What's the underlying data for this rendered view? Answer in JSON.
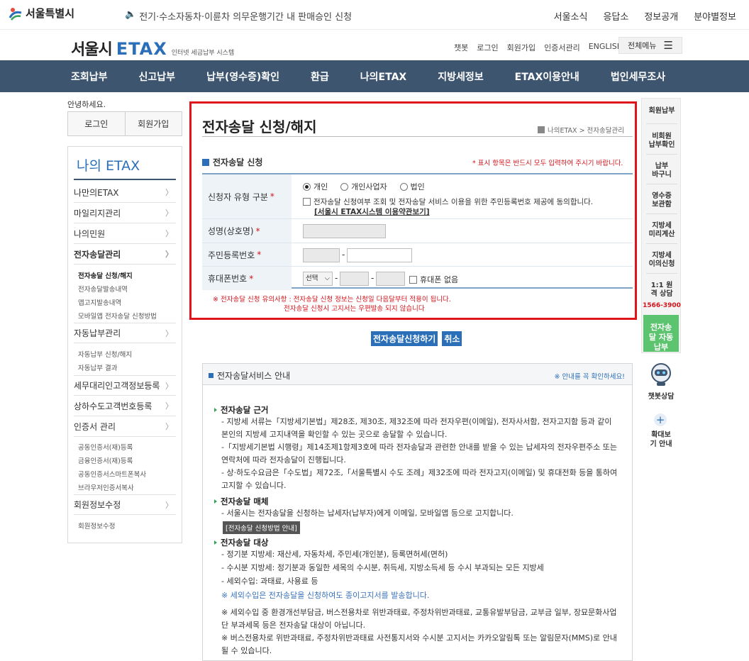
{
  "top": {
    "org": "서울특별시",
    "notice": "전기·수소자동차·이륜차 의무운행기간 내 판매승인 신청",
    "links": [
      "서울소식",
      "응답소",
      "정보공개",
      "분야별정보"
    ]
  },
  "brand": {
    "name_ko": "서울시",
    "name_en": "ETAX",
    "subtitle": "인터넷 세금납부 시스템"
  },
  "util": {
    "links": [
      "챗봇",
      "로그인",
      "회원가입",
      "인증서관리",
      "ENGLISH"
    ],
    "allmenu": "전체메뉴"
  },
  "gnb": [
    "조회납부",
    "신고납부",
    "납부(영수증)확인",
    "환급",
    "나의ETAX",
    "지방세정보",
    "ETAX이용안내",
    "법인세무조사"
  ],
  "sidebar": {
    "hello": "안녕하세요.",
    "login": "로그인",
    "join": "회원가입",
    "title": "나의 ETAX",
    "menu": [
      {
        "label": "나만의ETAX",
        "chev": "〉"
      },
      {
        "label": "마일리지관리",
        "chev": "〉"
      },
      {
        "label": "나의민원",
        "chev": "〉"
      },
      {
        "label": "전자송달관리",
        "chev": "〉"
      },
      {
        "label": "자동납부관리",
        "chev": "〉"
      },
      {
        "label": "세무대리인고객정보등록",
        "chev": "〉"
      },
      {
        "label": "상하수도고객번호등록",
        "chev": "〉"
      },
      {
        "label": "인증서 관리",
        "chev": "〉"
      },
      {
        "label": "회원정보수정",
        "chev": "〉"
      }
    ],
    "sub_edelivery": [
      "전자송달 신청/해지",
      "전자송달발송내역",
      "앱고지발송내역",
      "모바일앱 전자송달 신청방법"
    ],
    "sub_autopay": [
      "자동납부 신청/해지",
      "자동납부 결과"
    ],
    "sub_cert": [
      "공동인증서(재)등록",
      "금융인증서(재)등록",
      "공동인증서스마트폰복사",
      "브라우저인증서복사"
    ],
    "sub_member": [
      "회원정보수정"
    ]
  },
  "main": {
    "title": "전자송달 신청/해지",
    "breadcrumb": "나의ETAX > 전자송달관리",
    "section": "전자송달 신청",
    "req_note": "* 표시 항목은 반드시 모두 입력하여 주시기 바랍니다.",
    "form": {
      "type_label": "신청자 유형 구분",
      "types": [
        "개인",
        "개인사업자",
        "법인"
      ],
      "consent": "전자송달 신청여부 조회 및 전자송달 서비스 이용을 위한 주민등록번호 제공에 동의합니다.",
      "terms_link": "[서울시 ETAX시스템 이용약관보기]",
      "name_label": "성명(상호명)",
      "rrn_label": "주민등록번호",
      "phone_label": "휴대폰번호",
      "phone_select": "선택",
      "no_phone": "휴대폰 없음",
      "dash": "-"
    },
    "warn1": "※ 전자송달 신청 유의사항 : 전자송달 신청 정보는 신청일 다음달부터 적용이 됩니다.",
    "warn2": "전자송달 신청시 고지서는 우편발송 되지 않습니다",
    "apply_btn": "전자송달신청하기",
    "cancel_btn": "취소"
  },
  "guide": {
    "title": "전자송달서비스 안내",
    "note": "※ 안내를 꼭 확인하세요!",
    "h1": "전자송달 근거",
    "h1_lines": [
      "- 지방세 서류는「지방세기본법」제28조, 제30조, 제32조에 따라 전자우편(이메일), 전자사서함, 전자고지함 등과 같이 본인의 지방세 고지내역을 확인할 수 있는 곳으로 송달할 수 있습니다.",
      "-「지방세기본법 시행령」제14조제1항제3호에 따라 전자송달과 관련한 안내를 받을 수 있는 납세자의 전자우편주소 또는 연락처에 따라 전자송달이 진행됩니다.",
      "- 상·하도수요금은「수도법」제72조,「서울특별시 수도 조례」제32조에 따라 전자고지(이메일) 및 휴대전화 등을 통하여 고지할 수 있습니다."
    ],
    "h2": "전자송달 매체",
    "h2_lines": [
      "- 서울시는 전자송달을 신청하는 납세자(납부자)에게 이메일, 모바일앱 등으로 고지합니다."
    ],
    "h2_btn": "[전자송달 신청방법 안내]",
    "h3": "전자송달 대상",
    "h3_lines": [
      "- 정기분 지방세: 재산세, 자동차세, 주민세(개인분), 등록면허세(면허)",
      "- 수시분 지방세: 정기분과 동일한 세목의 수시분, 취득세, 지방소득세 등 수시 부과되는 모든 지방세",
      "- 세외수입: 과태료, 사용료 등"
    ],
    "blue_note": "※ 세외수입은 전자송달을 신청하여도 종이고지서를 발송합니다.",
    "note2": "※ 세외수입 중 환경개선부담금, 버스전용차로 위반과태료, 주정차위반과태료, 교통유발부담금, 교부금 일부, 장묘문화사업단 부과세목 등은 전자송달 대상이 아닙니다.",
    "note3": "※ 버스전용차로 위반과태료, 주정차위반과태료 사전통지서와 수시분 고지서는 카카오알림톡 또는 알림문자(MMS)로 안내될 수 있습니다."
  },
  "quick": {
    "items": [
      "회원납부",
      "비회원 납부확인",
      "납부 바구니",
      "영수증 보관함",
      "지방세 미리계산",
      "지방세 이의신청"
    ],
    "consult": "1:1 원격 상담",
    "phone": "1566-3900",
    "green": "전자송달 자동납부",
    "chatbot": "챗봇상담",
    "zoom": "확대보기 안내",
    "zoom_glyph": "+"
  },
  "colors": {
    "nav": "#3e5570",
    "accent": "#2a6fb8",
    "highlight": "#e0141b",
    "green": "#5cc46e"
  }
}
